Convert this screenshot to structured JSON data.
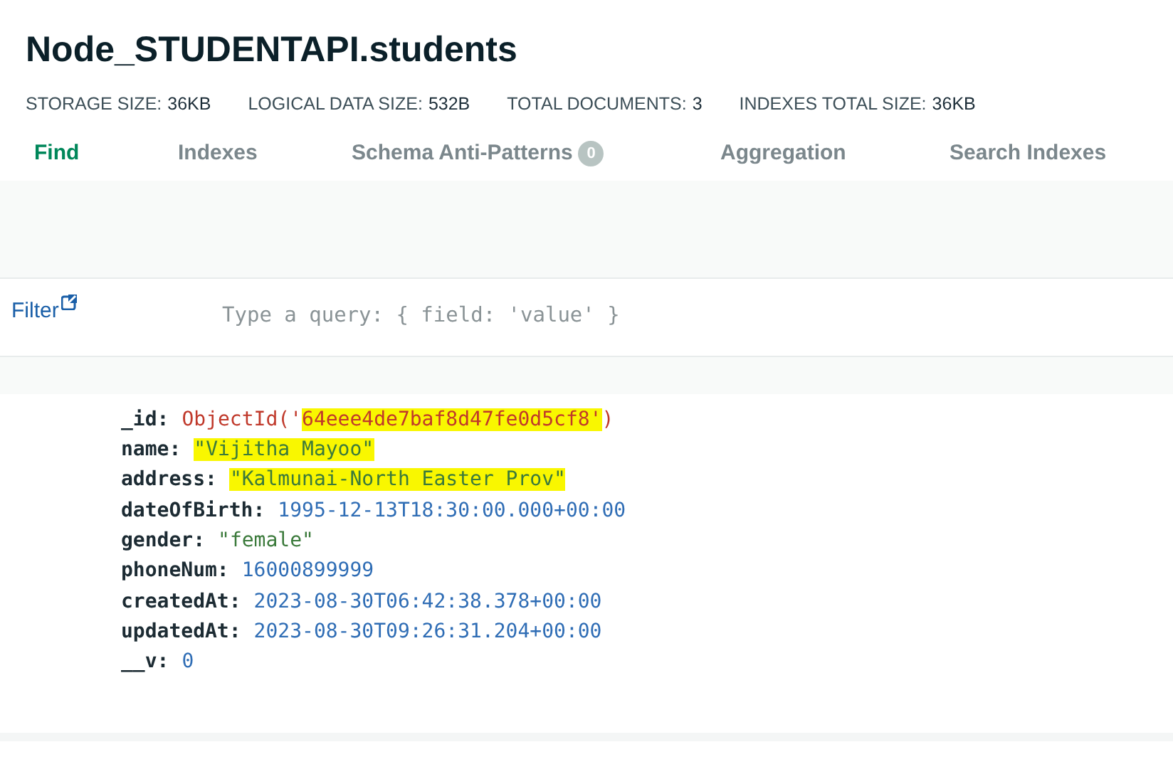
{
  "title": "Node_STUDENTAPI.students",
  "stats": [
    {
      "label": "STORAGE SIZE:",
      "value": "36KB"
    },
    {
      "label": "LOGICAL DATA SIZE:",
      "value": "532B"
    },
    {
      "label": "TOTAL DOCUMENTS:",
      "value": "3"
    },
    {
      "label": "INDEXES TOTAL SIZE:",
      "value": "36KB"
    }
  ],
  "tabs": [
    {
      "label": "Find",
      "selected": true
    },
    {
      "label": "Indexes",
      "selected": false
    },
    {
      "label": "Schema Anti-Patterns",
      "selected": false,
      "badge": "0"
    },
    {
      "label": "Aggregation",
      "selected": false
    },
    {
      "label": "Search Indexes",
      "selected": false
    }
  ],
  "filter": {
    "label": "Filter",
    "placeholder": "Type a query: { field: 'value' }"
  },
  "document": [
    {
      "key": "_id:",
      "kind": "objectid",
      "segments": [
        {
          "text": "ObjectId('",
          "highlighted": false
        },
        {
          "text": "64eee4de7baf8d47fe0d5cf8'",
          "highlighted": true
        },
        {
          "text": ")",
          "highlighted": false
        }
      ]
    },
    {
      "key": "name:",
      "kind": "string",
      "segments": [
        {
          "text": "\"Vijitha Mayoo\"",
          "highlighted": true
        }
      ]
    },
    {
      "key": "address:",
      "kind": "string",
      "segments": [
        {
          "text": "\"Kalmunai-North Easter Prov\"",
          "highlighted": true
        }
      ]
    },
    {
      "key": "dateOfBirth:",
      "kind": "date",
      "segments": [
        {
          "text": "1995-12-13T18:30:00.000+00:00",
          "highlighted": false
        }
      ]
    },
    {
      "key": "gender:",
      "kind": "string",
      "segments": [
        {
          "text": "\"female\"",
          "highlighted": false
        }
      ]
    },
    {
      "key": "phoneNum:",
      "kind": "number",
      "segments": [
        {
          "text": "16000899999",
          "highlighted": false
        }
      ]
    },
    {
      "key": "createdAt:",
      "kind": "date",
      "segments": [
        {
          "text": "2023-08-30T06:42:38.378+00:00",
          "highlighted": false
        }
      ]
    },
    {
      "key": "updatedAt:",
      "kind": "date",
      "segments": [
        {
          "text": "2023-08-30T09:26:31.204+00:00",
          "highlighted": false
        }
      ]
    },
    {
      "key": "__v:",
      "kind": "number",
      "segments": [
        {
          "text": "0",
          "highlighted": false
        }
      ]
    }
  ]
}
